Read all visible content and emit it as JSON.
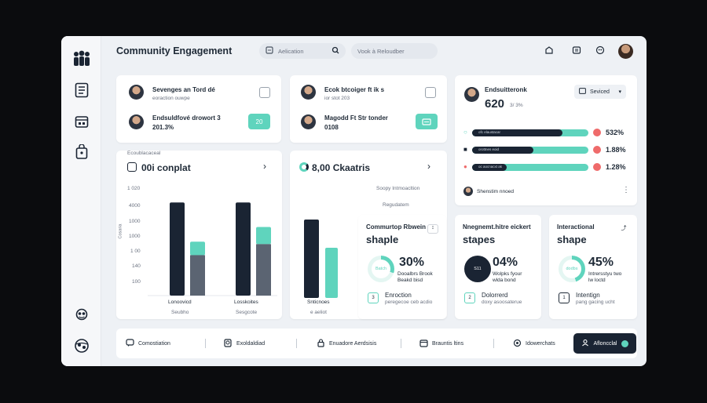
{
  "header": {
    "title": "Community Engagement",
    "search_placeholder": "Aelication",
    "search2_placeholder": "Vook à Reloudber"
  },
  "colors": {
    "accent": "#5fd4bd",
    "dark": "#1a2433",
    "alert": "#ef6b6b"
  },
  "sidebar": {
    "icons": [
      "people-icon",
      "document-icon",
      "calendar-icon",
      "bag-icon",
      "settings-icon",
      "globe-icon"
    ]
  },
  "card1": {
    "row1_name": "Sevenges an Tord dé",
    "row1_sub": "eoraction ouwpe",
    "row2_name": "Endsuldfové drowort 3",
    "row2_sub": "201.3%",
    "btn": "20"
  },
  "card2": {
    "row1_name": "Ecok btcoiger ft ik s",
    "row1_sub": "ior stot 203",
    "row2_name": "Magodd Ft Str tonder",
    "row2_sub": "0108"
  },
  "card3": {
    "name": "Endsuitteronk",
    "value": "620",
    "value_sub": "3/ 3%",
    "dropdown": "Seviced",
    "rows": [
      {
        "label": "ofc elaustacar",
        "pct": "532%",
        "fill": 0.78
      },
      {
        "label": "orottnes eoid",
        "pct": "1.88%",
        "fill": 0.53
      },
      {
        "label": "oc aocnacxt ak",
        "pct": "1.28%",
        "fill": 0.3
      }
    ],
    "footer": "Shenstim nnoed"
  },
  "chart1": {
    "header_small": "Ecoublacaceal",
    "title": "00i conplat",
    "yticks": [
      "1 020",
      "4000",
      "1000",
      "1000",
      "1 00",
      "140",
      "100"
    ],
    "ylabel": "Cosaria",
    "groups": [
      {
        "label": "Lonoovicd",
        "sub": "Seubho"
      },
      {
        "label": "Losskoites",
        "sub": "Sesgcote"
      }
    ]
  },
  "chart_data": {
    "type": "bar",
    "categories": [
      "Lonoovicd",
      "Losskoites"
    ],
    "series": [
      {
        "values": [
          0.95,
          0.95
        ]
      },
      {
        "values": [
          0.55,
          0.7
        ]
      }
    ]
  },
  "card4": {
    "title": "8,00 Ckaatris",
    "small1": "Soopy Intmoacltion",
    "small2": "Regudatem",
    "bar_label": "Snticnoes",
    "bar_sub": "e aeliot"
  },
  "card5": {
    "title_small": "Commurtop Rbwein",
    "title": "shaple",
    "pct": "30%",
    "gauge_label": "Batch",
    "gauge_value": 0.3,
    "desc1": "Dooalbrs Brook",
    "desc2": "Beakd bisd",
    "btn": "3",
    "footer1": "Enroction",
    "footer2": "peregecoe ceb acdio"
  },
  "card6": {
    "title_small": "Nnegnemt.hitre eickert",
    "title": "stapes",
    "pct": "04%",
    "gauge_label": "S11",
    "gauge_value": 0.04,
    "desc1": "Wolpks fyour",
    "desc2": "wlda bond",
    "btn": "2",
    "footer1": "Dolorrerd",
    "footer2": "doxy asoosaterue"
  },
  "card7": {
    "title_small": "Interactional",
    "title": "shape",
    "pct": "45%",
    "gauge_label": "dodbs",
    "gauge_value": 0.45,
    "desc1": "Intrersstyu two",
    "desc2": "lw loctd",
    "btn": "1",
    "footer1": "Intentign",
    "footer2": "pang gacing ucht"
  },
  "bottom_nav": {
    "items": [
      "Comostiation",
      "Exoldaldiad",
      "Enuadore Aerdsisis",
      "Brauntis ltins",
      "Idowerchats"
    ],
    "active": "Afloncclal"
  }
}
